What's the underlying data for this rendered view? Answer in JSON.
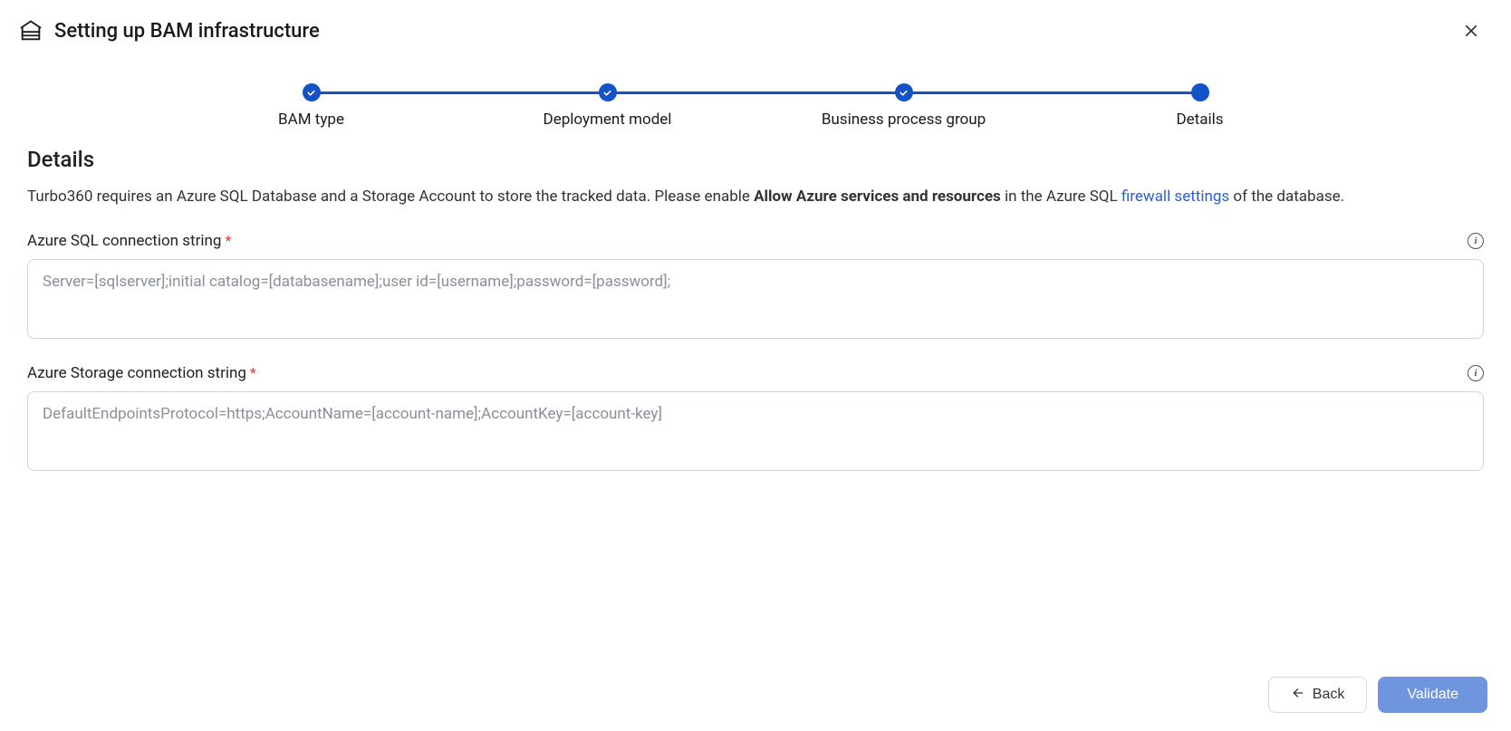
{
  "header": {
    "title": "Setting up BAM infrastructure"
  },
  "stepper": {
    "steps": [
      {
        "label": "BAM type"
      },
      {
        "label": "Deployment model"
      },
      {
        "label": "Business process group"
      },
      {
        "label": "Details"
      }
    ]
  },
  "section": {
    "heading": "Details",
    "desc_pre": "Turbo360 requires an Azure SQL Database and a Storage Account to store the tracked data. Please enable ",
    "desc_bold": "Allow Azure services and resources",
    "desc_mid": " in the Azure SQL ",
    "desc_link": "firewall settings",
    "desc_post": " of the database."
  },
  "fields": {
    "sql": {
      "label": "Azure SQL connection string",
      "placeholder": "Server=[sqlserver];initial catalog=[databasename];user id=[username];password=[password];",
      "value": ""
    },
    "storage": {
      "label": "Azure Storage connection string",
      "placeholder": "DefaultEndpointsProtocol=https;AccountName=[account-name];AccountKey=[account-key]",
      "value": ""
    }
  },
  "buttons": {
    "back": "Back",
    "validate": "Validate"
  }
}
